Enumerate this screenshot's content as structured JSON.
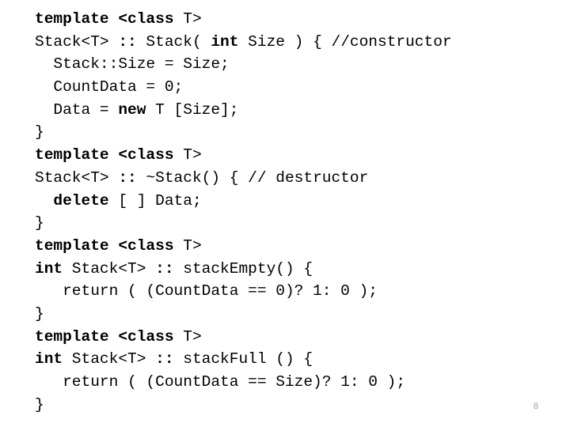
{
  "slide": {
    "background_color": "#ffffff",
    "text_color": "#000000",
    "page_number": "8",
    "page_number_color": "#9a9a9a"
  },
  "code": {
    "language": "cpp",
    "lines": [
      {
        "id": "line-1",
        "text": "template <class T>",
        "tokens": [
          {
            "t": "template",
            "bold": true
          },
          {
            "t": " ",
            "bold": false
          },
          {
            "t": "<class",
            "bold": true
          },
          {
            "t": " T>",
            "bold": false
          }
        ]
      },
      {
        "id": "line-2",
        "text": "Stack<T> :: Stack( int Size ) { //constructor",
        "tokens": [
          {
            "t": "Stack<T> ",
            "bold": false
          },
          {
            "t": "::",
            "bold": true
          },
          {
            "t": " Stack( ",
            "bold": false
          },
          {
            "t": "int",
            "bold": true
          },
          {
            "t": " Size ) { //constructor",
            "bold": false
          }
        ]
      },
      {
        "id": "line-3",
        "text": "  Stack::Size = Size;",
        "tokens": [
          {
            "t": "  Stack::Size = Size;",
            "bold": false
          }
        ]
      },
      {
        "id": "line-4",
        "text": "  CountData = 0;",
        "tokens": [
          {
            "t": "  CountData = 0;",
            "bold": false
          }
        ]
      },
      {
        "id": "line-5",
        "text": "  Data = new T [Size];",
        "tokens": [
          {
            "t": "  Data = ",
            "bold": false
          },
          {
            "t": "new",
            "bold": true
          },
          {
            "t": " T [Size];",
            "bold": false
          }
        ]
      },
      {
        "id": "line-6",
        "text": "}",
        "tokens": [
          {
            "t": "}",
            "bold": false
          }
        ]
      },
      {
        "id": "line-7",
        "text": "template <class T>",
        "tokens": [
          {
            "t": "template",
            "bold": true
          },
          {
            "t": " ",
            "bold": false
          },
          {
            "t": "<class",
            "bold": true
          },
          {
            "t": " T>",
            "bold": false
          }
        ]
      },
      {
        "id": "line-8",
        "text": "Stack<T> :: ~Stack() { // destructor",
        "tokens": [
          {
            "t": "Stack<T> ",
            "bold": false
          },
          {
            "t": "::",
            "bold": true
          },
          {
            "t": " ~Stack() { // destructor",
            "bold": false
          }
        ]
      },
      {
        "id": "line-9",
        "text": "  delete [ ] Data;",
        "tokens": [
          {
            "t": "  ",
            "bold": false
          },
          {
            "t": "delete",
            "bold": true
          },
          {
            "t": " [ ] Data;",
            "bold": false
          }
        ]
      },
      {
        "id": "line-10",
        "text": "}",
        "tokens": [
          {
            "t": "}",
            "bold": false
          }
        ]
      },
      {
        "id": "line-11",
        "text": "template <class T>",
        "tokens": [
          {
            "t": "template",
            "bold": true
          },
          {
            "t": " ",
            "bold": false
          },
          {
            "t": "<class",
            "bold": true
          },
          {
            "t": " T>",
            "bold": false
          }
        ]
      },
      {
        "id": "line-12",
        "text": "int Stack<T> :: stackEmpty() {",
        "tokens": [
          {
            "t": "int",
            "bold": true
          },
          {
            "t": " Stack<T> ",
            "bold": false
          },
          {
            "t": "::",
            "bold": true
          },
          {
            "t": " stackEmpty() {",
            "bold": false
          }
        ]
      },
      {
        "id": "line-13",
        "text": "   return ( (CountData == 0)? 1: 0 );",
        "tokens": [
          {
            "t": "   return ( (CountData == 0)? 1: 0 );",
            "bold": false
          }
        ]
      },
      {
        "id": "line-14",
        "text": "}",
        "tokens": [
          {
            "t": "}",
            "bold": false
          }
        ]
      },
      {
        "id": "line-15",
        "text": "template <class T>",
        "tokens": [
          {
            "t": "template",
            "bold": true
          },
          {
            "t": " ",
            "bold": false
          },
          {
            "t": "<class",
            "bold": true
          },
          {
            "t": " T>",
            "bold": false
          }
        ]
      },
      {
        "id": "line-16",
        "text": "int Stack<T> :: stackFull () {",
        "tokens": [
          {
            "t": "int",
            "bold": true
          },
          {
            "t": " Stack<T> ",
            "bold": false
          },
          {
            "t": "::",
            "bold": true
          },
          {
            "t": " stackFull () {",
            "bold": false
          }
        ]
      },
      {
        "id": "line-17",
        "text": "   return ( (CountData == Size)? 1: 0 );",
        "tokens": [
          {
            "t": "   return ( (CountData == Size)? 1: 0 );",
            "bold": false
          }
        ]
      },
      {
        "id": "line-18",
        "text": "}",
        "tokens": [
          {
            "t": "}",
            "bold": false
          }
        ]
      }
    ]
  }
}
